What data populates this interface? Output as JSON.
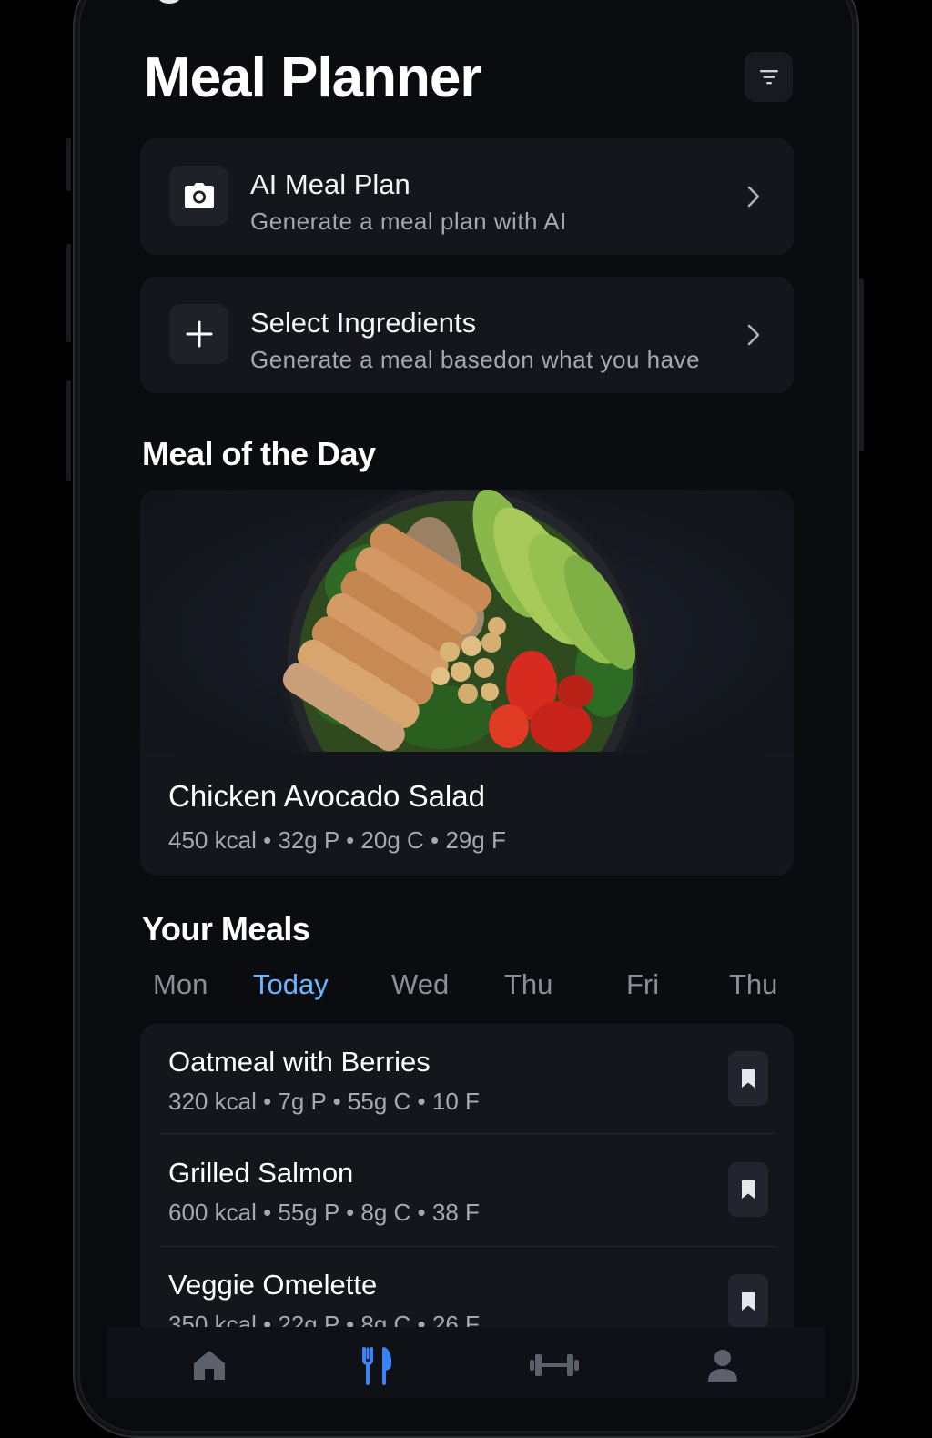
{
  "header": {
    "title": "Meal Planner"
  },
  "icons": {
    "filter": "filter-icon",
    "camera": "camera-icon",
    "plus": "plus-icon",
    "chevron": "chevron-right-icon",
    "bookmark": "bookmark-icon",
    "home": "home-icon",
    "utensils": "utensils-icon",
    "dumbbell": "dumbbell-icon",
    "profile": "person-icon"
  },
  "actions": [
    {
      "title": "AI Meal Plan",
      "subtitle": "Generate a meal plan with AI"
    },
    {
      "title": "Select Ingredients",
      "subtitle": "Generate a meal basedon what you have"
    }
  ],
  "meal_of_day": {
    "section_title": "Meal of the Day",
    "name": "Chicken Avocado Salad",
    "macros": "450 kcal • 32g P • 20g C • 29g F"
  },
  "your_meals": {
    "section_title": "Your Meals",
    "tabs": [
      "Mon",
      "Today",
      "Wed",
      "Thu",
      "Fri",
      "Thu"
    ],
    "active_tab": "Today",
    "items": [
      {
        "name": "Oatmeal with Berries",
        "macros": "320 kcal • 7g P • 55g C • 10 F"
      },
      {
        "name": "Grilled Salmon",
        "macros": "600 kcal • 55g P • 8g C • 38 F"
      },
      {
        "name": "Veggie Omelette",
        "macros": "350 kcal • 22g P • 8g C • 26 F"
      }
    ]
  },
  "tabbar": {
    "active": "utensils"
  },
  "colors": {
    "background": "#0b0c10",
    "card": "#14161b",
    "accent": "#3b82f6",
    "active_tab": "#6bb6ff",
    "muted_text": "#a5a8b0"
  }
}
